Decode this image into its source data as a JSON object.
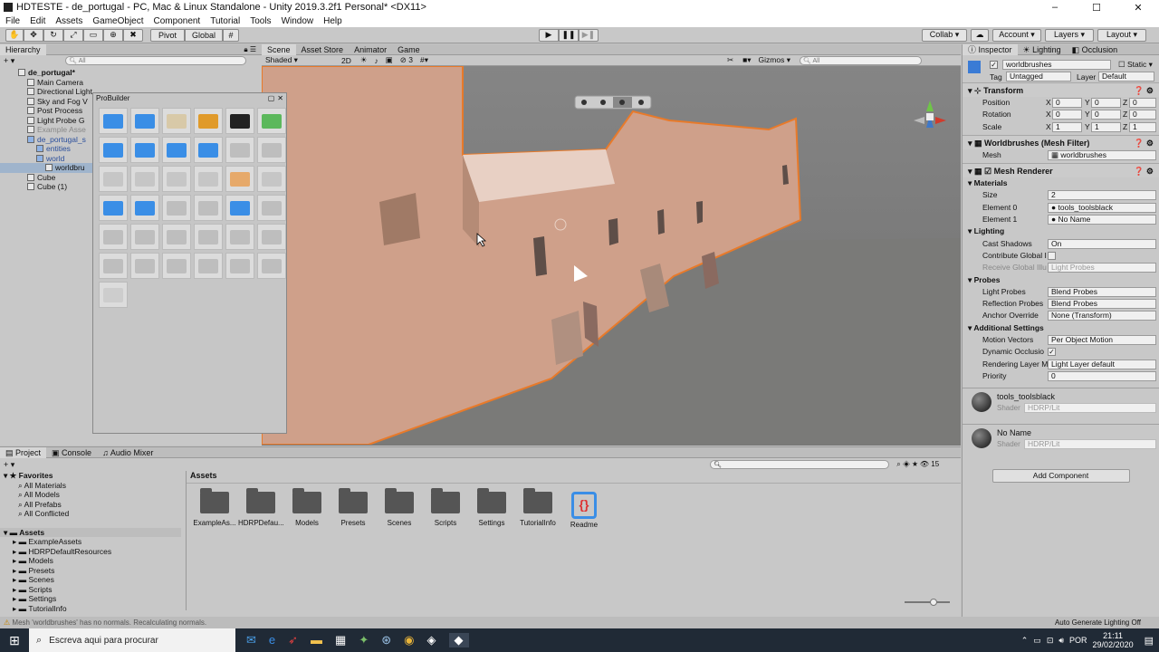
{
  "window": {
    "title": "HDTESTE - de_portugal - PC, Mac & Linux Standalone - Unity 2019.3.2f1 Personal* <DX11>",
    "controls": [
      "–",
      "☐",
      "✕"
    ]
  },
  "menu": [
    "File",
    "Edit",
    "Assets",
    "GameObject",
    "Component",
    "Tutorial",
    "Tools",
    "Window",
    "Help"
  ],
  "toolbar": {
    "pivot": "Pivot",
    "global": "Global",
    "collab": "Collab ▾",
    "account": "Account ▾",
    "layers": "Layers ▾",
    "layout": "Layout ▾"
  },
  "hierarchy": {
    "tab": "Hierarchy",
    "search_placeholder": "All",
    "items": [
      {
        "label": "de_portugal*",
        "indent": 0,
        "bold": true
      },
      {
        "label": "Main Camera",
        "indent": 1
      },
      {
        "label": "Directional Light",
        "indent": 1
      },
      {
        "label": "Sky and Fog V",
        "indent": 1
      },
      {
        "label": "Post Process",
        "indent": 1
      },
      {
        "label": "Light Probe G",
        "indent": 1
      },
      {
        "label": "Example Asse",
        "indent": 1,
        "muted": true
      },
      {
        "label": "de_portugal_s",
        "indent": 1,
        "blue": true
      },
      {
        "label": "entities",
        "indent": 2,
        "blue": true
      },
      {
        "label": "world",
        "indent": 2,
        "blue": true
      },
      {
        "label": "worldbru",
        "indent": 3,
        "selected": true
      },
      {
        "label": "Cube",
        "indent": 1
      },
      {
        "label": "Cube (1)",
        "indent": 1
      }
    ]
  },
  "probuilder": {
    "title": "ProBuilder"
  },
  "scene": {
    "tabs": [
      "Scene",
      "Asset Store",
      "Animator",
      "Game"
    ],
    "shading": "Shaded",
    "mode_2d": "2D",
    "layer_count": "3",
    "gizmos": "Gizmos",
    "search_placeholder": "All"
  },
  "inspector": {
    "tabs": [
      "Inspector",
      "Lighting",
      "Occlusion"
    ],
    "object_name": "worldbrushes",
    "static_label": "Static",
    "tag_label": "Tag",
    "tag_value": "Untagged",
    "layer_label": "Layer",
    "layer_value": "Default",
    "transform_title": "Transform",
    "position": {
      "label": "Position",
      "x": "0",
      "y": "0",
      "z": "0"
    },
    "rotation": {
      "label": "Rotation",
      "x": "0",
      "y": "0",
      "z": "0"
    },
    "scale": {
      "label": "Scale",
      "x": "1",
      "y": "1",
      "z": "1"
    },
    "mesh_filter_title": "Worldbrushes (Mesh Filter)",
    "mesh_label": "Mesh",
    "mesh_value": "worldbrushes",
    "mesh_renderer_title": "Mesh Renderer",
    "materials_label": "Materials",
    "size_label": "Size",
    "size_value": "2",
    "element0_label": "Element 0",
    "element0_value": "tools_toolsblack",
    "element1_label": "Element 1",
    "element1_value": "No Name",
    "lighting_label": "Lighting",
    "cast_shadows_label": "Cast Shadows",
    "cast_shadows_value": "On",
    "contribute_gi_label": "Contribute Global I",
    "receive_gi_label": "Receive Global Illu",
    "receive_gi_value": "Light Probes",
    "probes_label": "Probes",
    "light_probes_label": "Light Probes",
    "light_probes_value": "Blend Probes",
    "reflection_probes_label": "Reflection Probes",
    "reflection_probes_value": "Blend Probes",
    "anchor_override_label": "Anchor Override",
    "anchor_override_value": "None (Transform)",
    "additional_label": "Additional Settings",
    "motion_vectors_label": "Motion Vectors",
    "motion_vectors_value": "Per Object Motion",
    "dynamic_occlusion_label": "Dynamic Occlusio",
    "rendering_layer_label": "Rendering Layer M",
    "rendering_layer_value": "Light Layer default",
    "priority_label": "Priority",
    "priority_value": "0",
    "material1_name": "tools_toolsblack",
    "material2_name": "No Name",
    "shader_label": "Shader",
    "shader_value": "HDRP/Lit",
    "add_component": "Add Component"
  },
  "project": {
    "tabs": [
      "Project",
      "Console",
      "Audio Mixer"
    ],
    "favorites_label": "Favorites",
    "favorites": [
      "All Materials",
      "All Models",
      "All Prefabs",
      "All Conflicted"
    ],
    "assets_label": "Assets",
    "asset_tree": [
      "ExampleAssets",
      "HDRPDefaultResources",
      "Models",
      "Presets",
      "Scenes",
      "Scripts",
      "Settings",
      "TutorialInfo"
    ],
    "breadcrumb": "Assets",
    "folders": [
      "ExampleAs...",
      "HDRPDefau...",
      "Models",
      "Presets",
      "Scenes",
      "Scripts",
      "Settings",
      "TutorialInfo"
    ],
    "readme": "Readme",
    "count": "15"
  },
  "status": {
    "message": "Mesh 'worldbrushes' has no normals. Recalculating normals.",
    "right": "Auto Generate Lighting Off"
  },
  "taskbar": {
    "search_placeholder": "Escreva aqui para procurar",
    "lang": "POR",
    "time": "21:11",
    "date": "29/02/2020"
  }
}
